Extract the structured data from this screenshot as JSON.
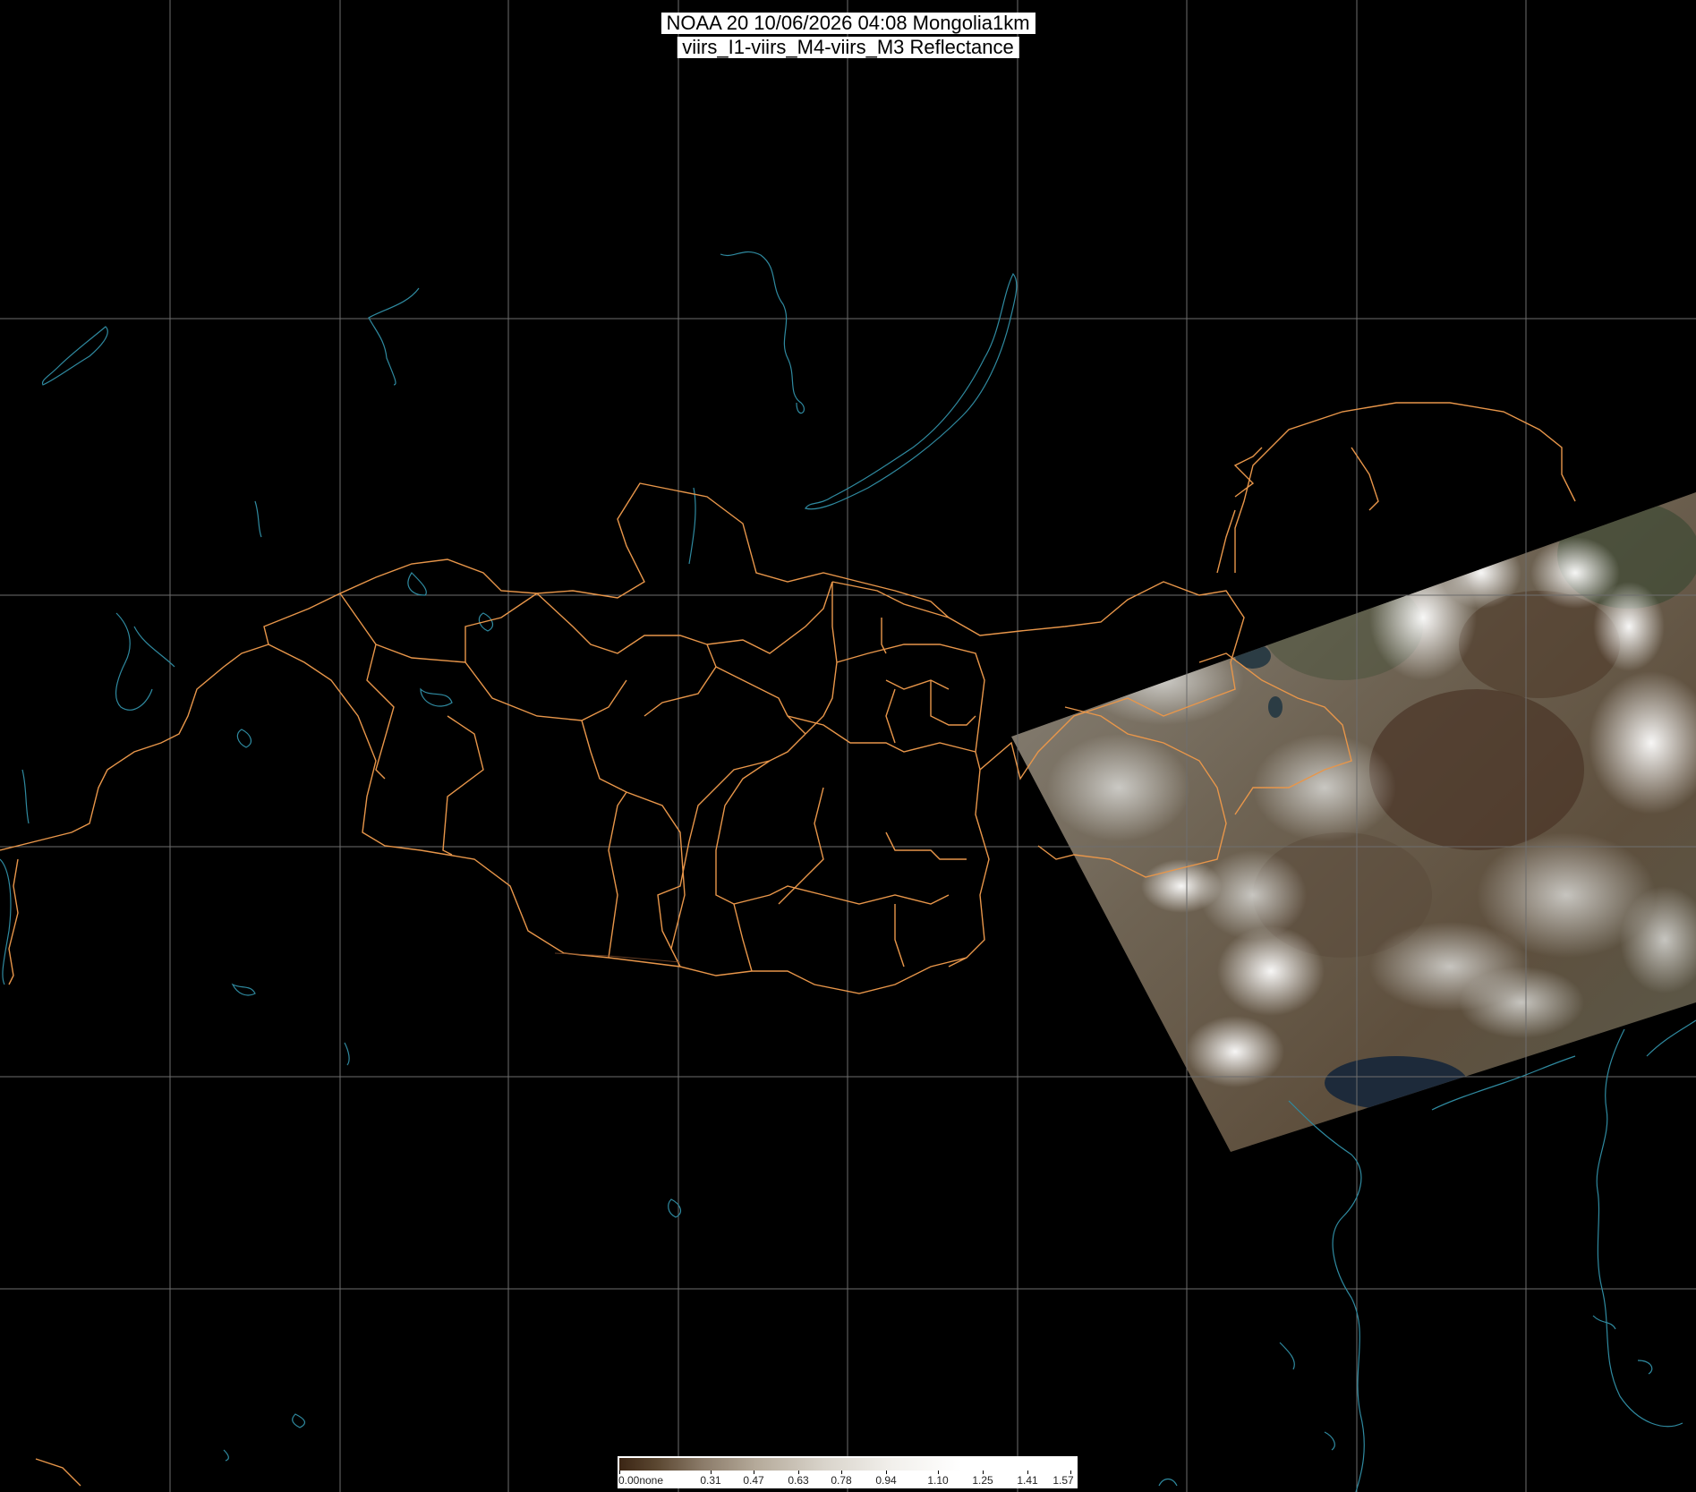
{
  "title": {
    "line1": "NOAA 20 10/06/2026 04:08 Mongolia1km",
    "line2": "viirs_I1-viirs_M4-viirs_M3 Reflectance"
  },
  "colors": {
    "background": "#000000",
    "grid": "#6e6e6e",
    "province_border": "#e8964a",
    "coast_water": "#2f8aa0"
  },
  "colorbar": {
    "ticks": [
      "0.00none",
      "0.31",
      "0.47",
      "0.63",
      "0.78",
      "0.94",
      "1.10",
      "1.25",
      "1.41",
      "1.57"
    ]
  }
}
